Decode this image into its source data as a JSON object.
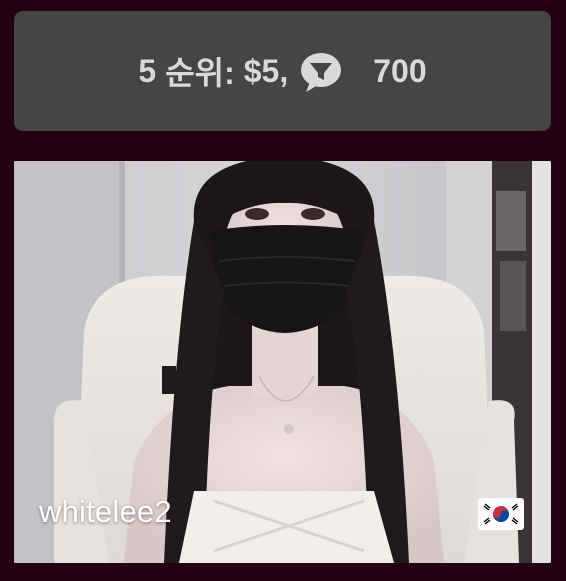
{
  "rank_banner": {
    "rank": "5",
    "rank_label": "순위:",
    "amount": "$5,",
    "icon": "speech-bubble-funnel-icon",
    "count": "700"
  },
  "stream": {
    "username": "whitelee2",
    "flag_icon": "south-korea-flag-icon"
  },
  "colors": {
    "page_background": "#250011",
    "banner_background": "#454545",
    "banner_text": "#d9d9d9"
  }
}
